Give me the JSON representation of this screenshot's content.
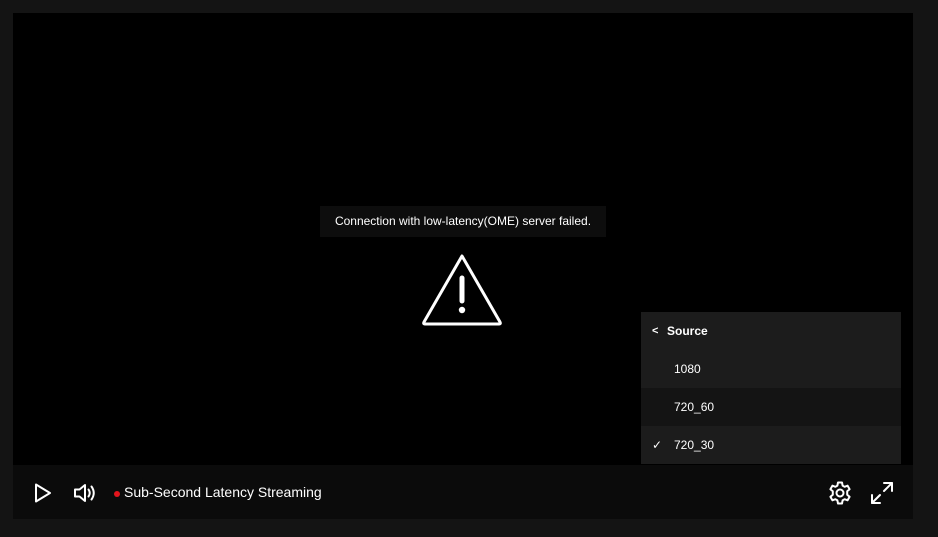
{
  "player": {
    "error_message": "Connection with low-latency(OME) server failed.",
    "warning_icon": "warning-triangle-icon",
    "quality_menu": {
      "back_glyph": "<",
      "title": "Source",
      "options": [
        {
          "label": "1080",
          "selected": false
        },
        {
          "label": "720_60",
          "selected": false
        },
        {
          "label": "720_30",
          "selected": true
        }
      ],
      "check_glyph": "✓"
    },
    "controls": {
      "play_icon": "play-icon",
      "volume_icon": "volume-icon",
      "live_indicator_color": "#e3141c",
      "stream_title": "Sub-Second Latency Streaming",
      "settings_icon": "gear-icon",
      "fullscreen_icon": "fullscreen-icon"
    }
  },
  "colors": {
    "page_background": "#141414",
    "video_background": "#000000",
    "menu_background": "#1c1c1c",
    "control_bar_background": "#0b0b0b"
  }
}
